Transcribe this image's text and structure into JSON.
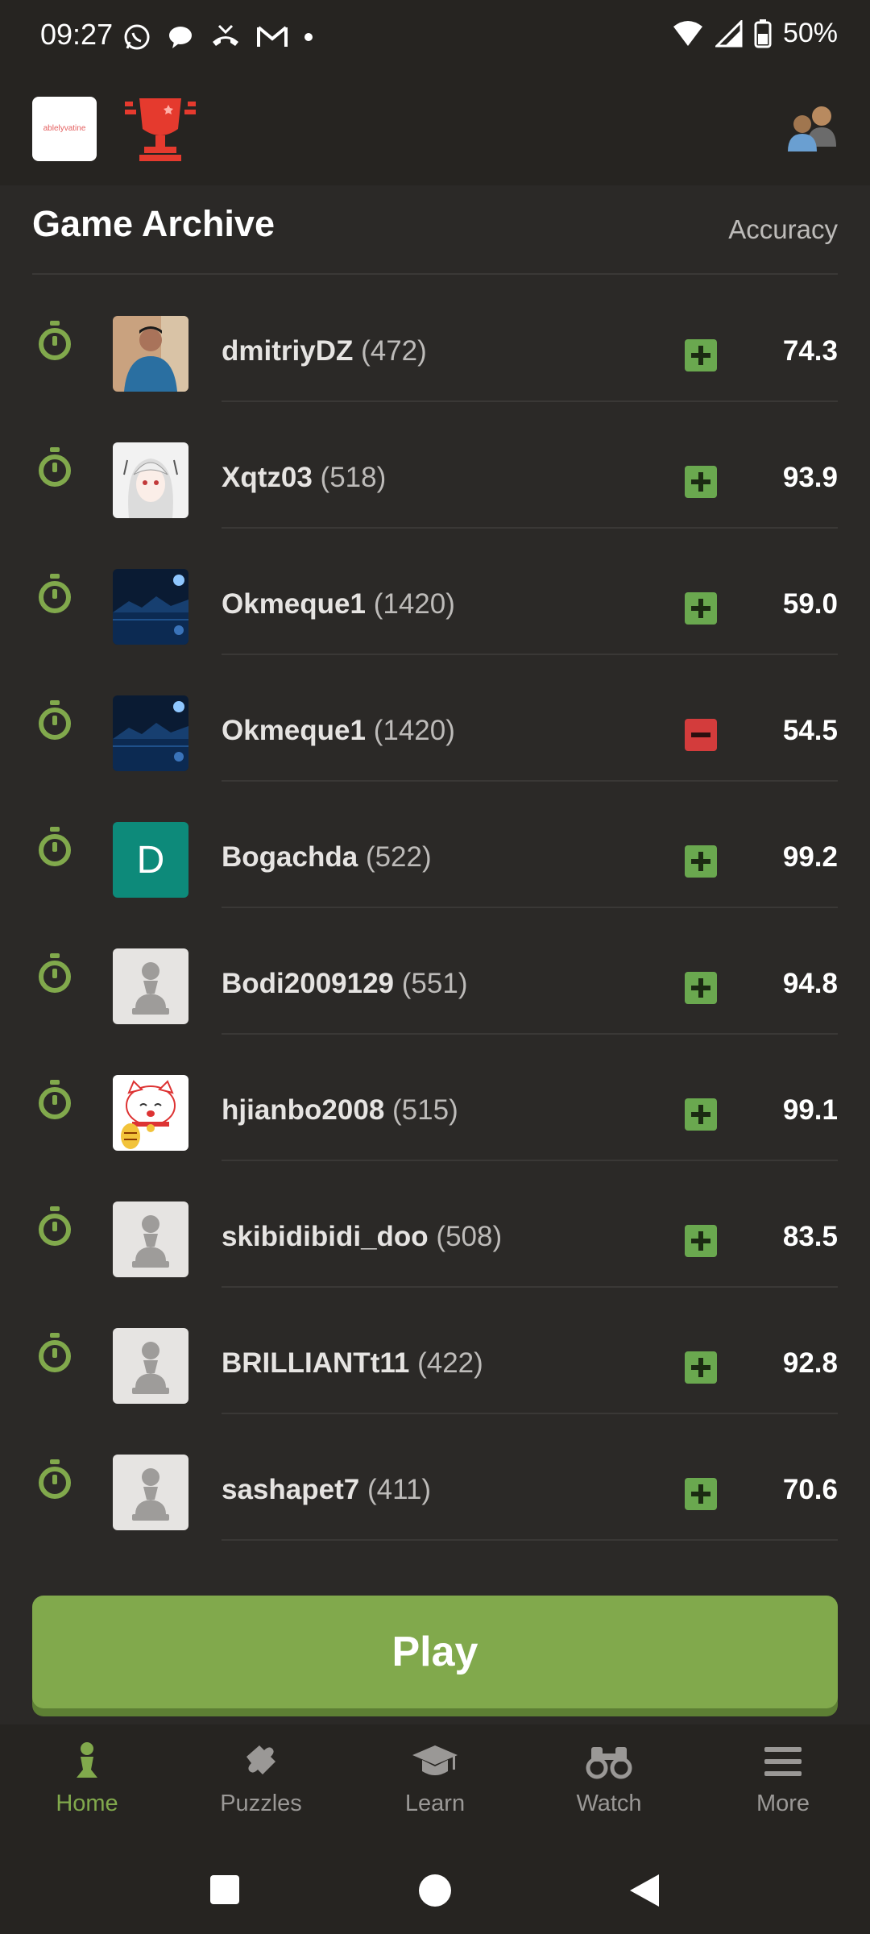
{
  "status_bar": {
    "time": "09:27",
    "notification_icons": [
      "whatsapp-icon",
      "chat-bubble-icon",
      "missed-call-icon",
      "gmail-icon",
      "dot-icon"
    ],
    "battery": "50%"
  },
  "header": {
    "logo_text": "ablelyvatine",
    "trophy_icon": "trophy-icon",
    "friends_icon": "friends-icon"
  },
  "archive": {
    "title": "Game Archive",
    "accuracy_label": "Accuracy",
    "games": [
      {
        "name": "dmitriyDZ",
        "rating": "(472)",
        "result": "win",
        "accuracy": "74.3",
        "avatar": "photo-man"
      },
      {
        "name": "Xqtz03",
        "rating": "(518)",
        "result": "win",
        "accuracy": "93.9",
        "avatar": "anime"
      },
      {
        "name": "Okmeque1",
        "rating": "(1420)",
        "result": "win",
        "accuracy": "59.0",
        "avatar": "night-sky"
      },
      {
        "name": "Okmeque1",
        "rating": "(1420)",
        "result": "loss",
        "accuracy": "54.5",
        "avatar": "night-sky"
      },
      {
        "name": "Bogachda",
        "rating": "(522)",
        "result": "win",
        "accuracy": "99.2",
        "avatar": "letter-d"
      },
      {
        "name": "Bodi2009129",
        "rating": "(551)",
        "result": "win",
        "accuracy": "94.8",
        "avatar": "pawn"
      },
      {
        "name": "hjianbo2008",
        "rating": "(515)",
        "result": "win",
        "accuracy": "99.1",
        "avatar": "lucky-cat"
      },
      {
        "name": "skibidibidi_doo",
        "rating": "(508)",
        "result": "win",
        "accuracy": "83.5",
        "avatar": "pawn"
      },
      {
        "name": "BRILLIANTt11",
        "rating": "(422)",
        "result": "win",
        "accuracy": "92.8",
        "avatar": "pawn"
      },
      {
        "name": "sashapet7",
        "rating": "(411)",
        "result": "win",
        "accuracy": "70.6",
        "avatar": "pawn"
      }
    ],
    "avatar_letter": "D"
  },
  "play_button": "Play",
  "nav": {
    "home": "Home",
    "puzzles": "Puzzles",
    "learn": "Learn",
    "watch": "Watch",
    "more": "More"
  },
  "colors": {
    "accent": "#81a94c",
    "win": "#6aa84f",
    "loss": "#d33c3c",
    "background": "#2b2927"
  }
}
